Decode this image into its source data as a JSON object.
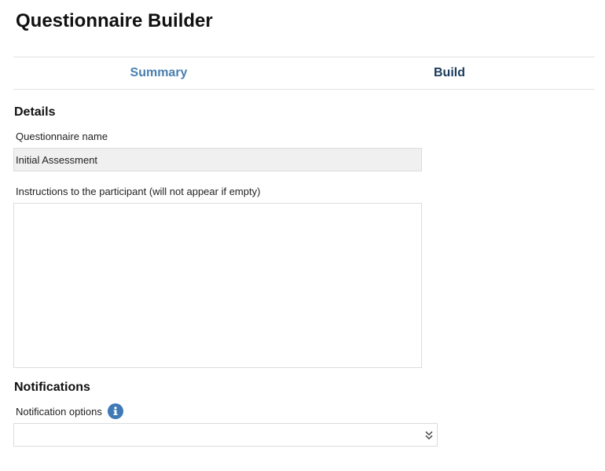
{
  "page": {
    "title": "Questionnaire Builder"
  },
  "tabs": [
    {
      "label": "Summary"
    },
    {
      "label": "Build"
    }
  ],
  "details": {
    "heading": "Details",
    "name_label": "Questionnaire name",
    "name_value": "Initial Assessment",
    "instructions_label": "Instructions to the participant (will not appear if empty)",
    "instructions_value": ""
  },
  "notifications": {
    "heading": "Notifications",
    "options_label": "Notification options",
    "info_icon": "info-icon",
    "selected_value": "",
    "chevron_icon": "double-chevron-down-icon"
  },
  "colors": {
    "tab_summary": "#4a7fb0",
    "tab_build": "#1b3a5c",
    "info_icon_bg": "#3f7ab6",
    "input_bg": "#f0f0f0",
    "border": "#dcdcdc"
  }
}
